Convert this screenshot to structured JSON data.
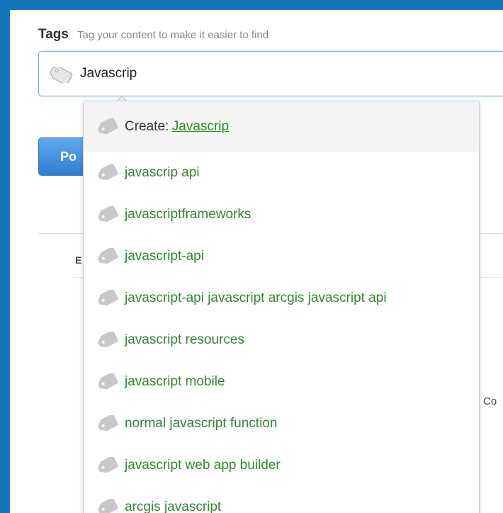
{
  "tags_section": {
    "title": "Tags",
    "hint": "Tag your content to make it easier to find"
  },
  "tag_input": {
    "value": "Javascrip"
  },
  "background": {
    "post_button_label": "Po",
    "partial_letter": "E",
    "partial_text_right": "Co"
  },
  "dropdown": {
    "create_prefix": "Create:",
    "create_value": "Javascrip",
    "suggestions": [
      "javascrip api",
      "javascriptframeworks",
      "javascript-api",
      "javascript-api javascript arcgis javascript api",
      "javascript resources",
      "javascript mobile",
      "normal javascript function",
      "javascript web app builder",
      "arcgis javascript"
    ]
  },
  "icons": {
    "tag": "tag-icon"
  },
  "colors": {
    "frame_border": "#1478b8",
    "suggestion_text": "#2d8a2d",
    "input_border": "#78aee0",
    "button_blue": "#2f7fd0"
  }
}
